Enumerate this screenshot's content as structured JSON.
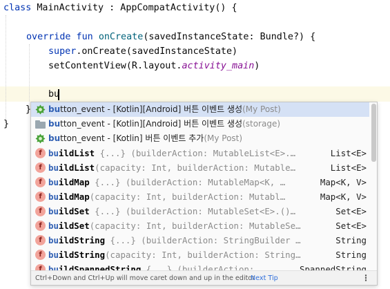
{
  "code": {
    "line1": {
      "kw": "class",
      "name": " MainActivity : AppCompatActivity() {"
    },
    "line3": {
      "kw": "override fun",
      "fn": "onCreate",
      "rest": "(savedInstanceState: Bundle?) {"
    },
    "line4": {
      "kw": "super",
      "rest": ".onCreate(savedInstanceState)"
    },
    "line5": {
      "plain": "setContentView(R.layout.",
      "italic": "activity_main",
      "close": ")"
    },
    "typed": "bu",
    "brace_inner": "}",
    "brace_outer": "}"
  },
  "completion": {
    "items": [
      {
        "icon": "live-template-icon",
        "match": "bu",
        "rest": "tton_event - [Kotlin][Android] 버튼 이벤트 생성",
        "source": "(My Post)",
        "selected": true
      },
      {
        "icon": "folder-icon",
        "match": "bu",
        "rest": "tton_event - [Kotlin][Android] 버튼 이벤트 생성",
        "source": "(storage)"
      },
      {
        "icon": "live-template-icon",
        "match": "bu",
        "rest": "tton_event - [Kotlin] 버튼 이벤트 추가",
        "source": "(My Post)"
      },
      {
        "icon": "function-icon",
        "match": "bu",
        "name": "ildList",
        "sig": " {...} (builderAction: MutableList<E>.…",
        "type": "List<E>"
      },
      {
        "icon": "function-icon",
        "match": "bu",
        "name": "ildList",
        "sig": "(capacity: Int, builderAction: Mutable…",
        "type": "List<E>"
      },
      {
        "icon": "function-icon",
        "match": "bu",
        "name": "ildMap",
        "sig": " {...} (builderAction: MutableMap<K, …",
        "type": "Map<K, V>"
      },
      {
        "icon": "function-icon",
        "match": "bu",
        "name": "ildMap",
        "sig": "(capacity: Int, builderAction: Mutabl…",
        "type": "Map<K, V>"
      },
      {
        "icon": "function-icon",
        "match": "bu",
        "name": "ildSet",
        "sig": " {...} (builderAction: MutableSet<E>.()…",
        "type": "Set<E>"
      },
      {
        "icon": "function-icon",
        "match": "bu",
        "name": "ildSet",
        "sig": "(capacity: Int, builderAction: MutableSe…",
        "type": "Set<E>"
      },
      {
        "icon": "function-icon",
        "match": "bu",
        "name": "ildString",
        "sig": " {...} (builderAction: StringBuilder …",
        "type": "String"
      },
      {
        "icon": "function-icon",
        "match": "bu",
        "name": "ildString",
        "sig": "(capacity: Int, builderAction: String…",
        "type": "String"
      },
      {
        "icon": "function-icon",
        "match": "bu",
        "name": "ildSpannedString",
        "sig": " {...} (builderAction:",
        "type": "SpannedString"
      }
    ],
    "footer_hint": "Ctrl+Down and Ctrl+Up will move caret down and up in the editor",
    "next_tip": "Next Tip",
    "more_icon": "more-options-icon"
  }
}
